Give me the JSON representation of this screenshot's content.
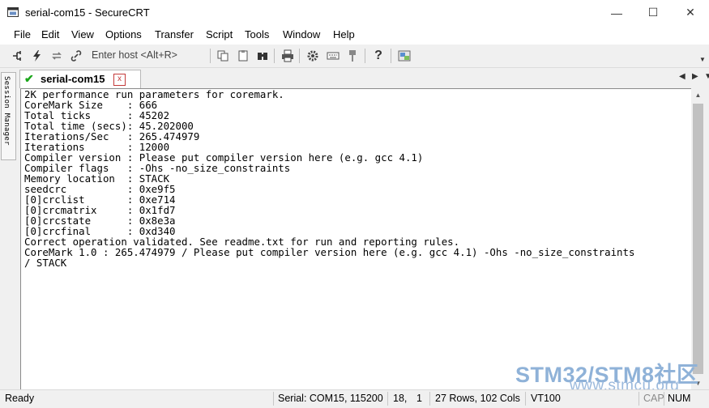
{
  "window": {
    "title": "serial-com15 - SecureCRT",
    "minimize_glyph": "—",
    "maximize_glyph": "☐",
    "close_glyph": "✕"
  },
  "menu": [
    "File",
    "Edit",
    "View",
    "Options",
    "Transfer",
    "Script",
    "Tools",
    "Window",
    "Help"
  ],
  "toolbar": {
    "quick_connect_placeholder": "Enter host <Alt+R>",
    "icons": [
      "connect-icon",
      "lightning-icon",
      "reconnect-icon",
      "link-icon",
      "copy-icon",
      "paste-icon",
      "find-icon",
      "print-icon",
      "settings-icon",
      "keymap-icon",
      "keychain-icon",
      "help-icon",
      "screenshot-icon"
    ]
  },
  "side_tab": {
    "label": "Session Manager"
  },
  "session_tab": {
    "label": "serial-com15",
    "close_glyph": "x",
    "status_color": "#1aa61a"
  },
  "tab_nav": {
    "prev": "◀",
    "next": "▶",
    "menu": "▼"
  },
  "terminal": {
    "lines": [
      "2K performance run parameters for coremark.",
      "CoreMark Size    : 666",
      "Total ticks      : 45202",
      "Total time (secs): 45.202000",
      "Iterations/Sec   : 265.474979",
      "Iterations       : 12000",
      "Compiler version : Please put compiler version here (e.g. gcc 4.1)",
      "Compiler flags   : -Ohs -no_size_constraints",
      "Memory location  : STACK",
      "seedcrc          : 0xe9f5",
      "[0]crclist       : 0xe714",
      "[0]crcmatrix     : 0x1fd7",
      "[0]crcstate      : 0x8e3a",
      "[0]crcfinal      : 0xd340",
      "Correct operation validated. See readme.txt for run and reporting rules.",
      "CoreMark 1.0 : 265.474979 / Please put compiler version here (e.g. gcc 4.1) -Ohs -no_size_constraints",
      "/ STACK"
    ]
  },
  "watermark": {
    "main": "STM32/STM8社区",
    "sub": "www.stmcu.org"
  },
  "status": {
    "ready": "Ready",
    "connection": "Serial: COM15, 115200",
    "row": "18,",
    "col": "1",
    "size": "27 Rows, 102 Cols",
    "emulation": "VT100",
    "caps": "CAP",
    "num": "NUM"
  }
}
